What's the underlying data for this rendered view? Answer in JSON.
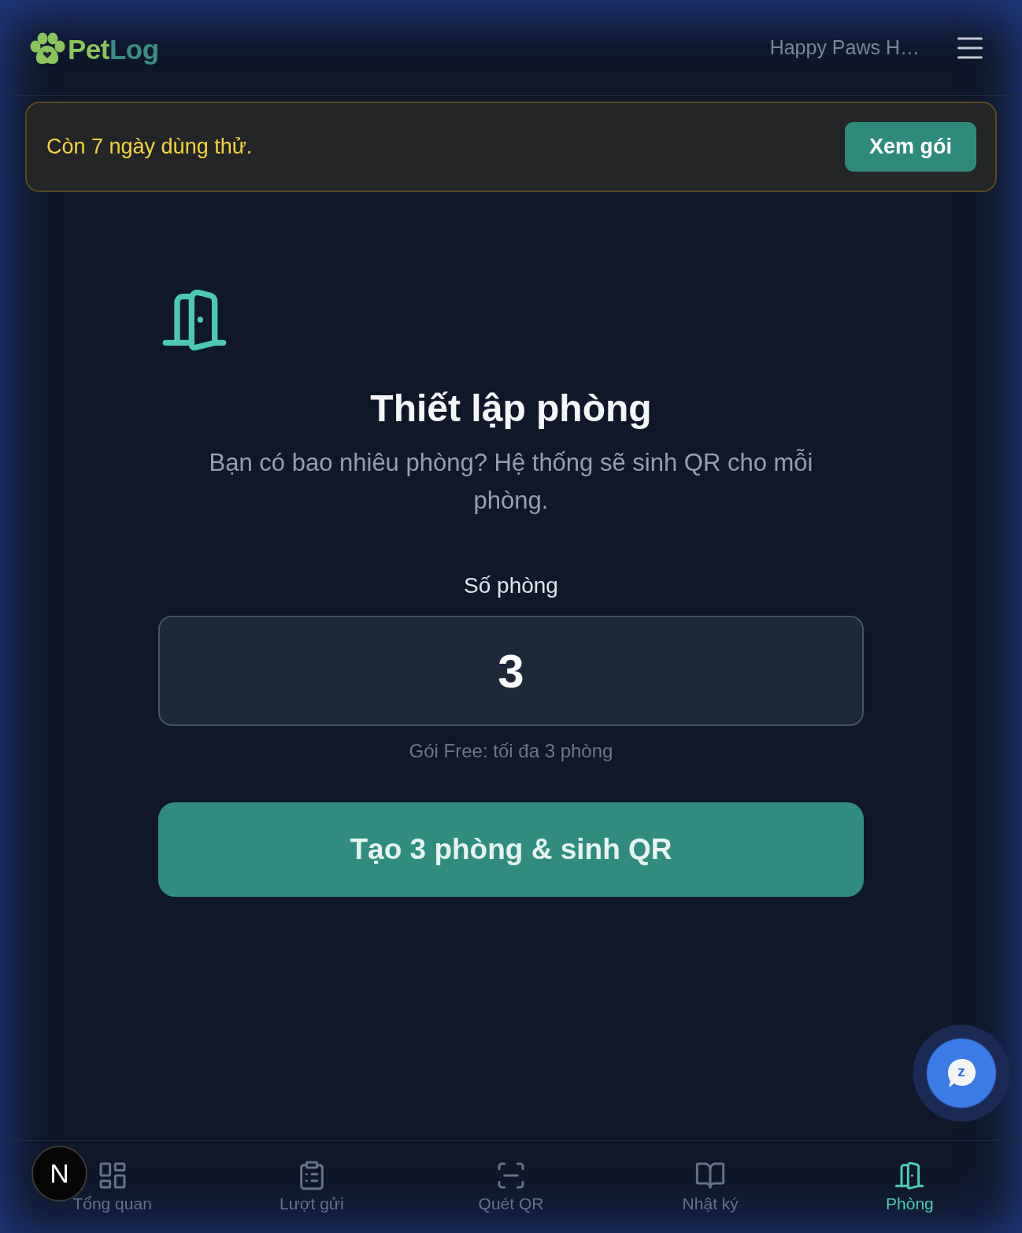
{
  "header": {
    "logo": {
      "first_part": "Pet",
      "second_part": "Log"
    },
    "account_name": "Happy Paws H…"
  },
  "trial_banner": {
    "message": "Còn 7 ngày dùng thử.",
    "button": "Xem gói"
  },
  "setup": {
    "title": "Thiết lập phòng",
    "subtitle": "Bạn có bao nhiêu phòng? Hệ thống sẽ sinh QR cho mỗi phòng.",
    "field": {
      "label": "Số phòng",
      "value": "3"
    },
    "hint": "Gói Free: tối đa 3 phòng",
    "submit": "Tạo 3 phòng & sinh QR"
  },
  "bottom_nav": [
    {
      "kind": "dashboard",
      "label": "Tổng quan",
      "selected": false
    },
    {
      "kind": "clipboard",
      "label": "Lượt gửi",
      "selected": false
    },
    {
      "kind": "scan",
      "label": "Quét QR",
      "selected": false
    },
    {
      "kind": "book",
      "label": "Nhật ký",
      "selected": false
    },
    {
      "kind": "door",
      "label": "Phòng",
      "selected": true
    }
  ],
  "chat_button": {
    "letter": "z"
  },
  "dev_badge": {
    "letter": "N"
  }
}
